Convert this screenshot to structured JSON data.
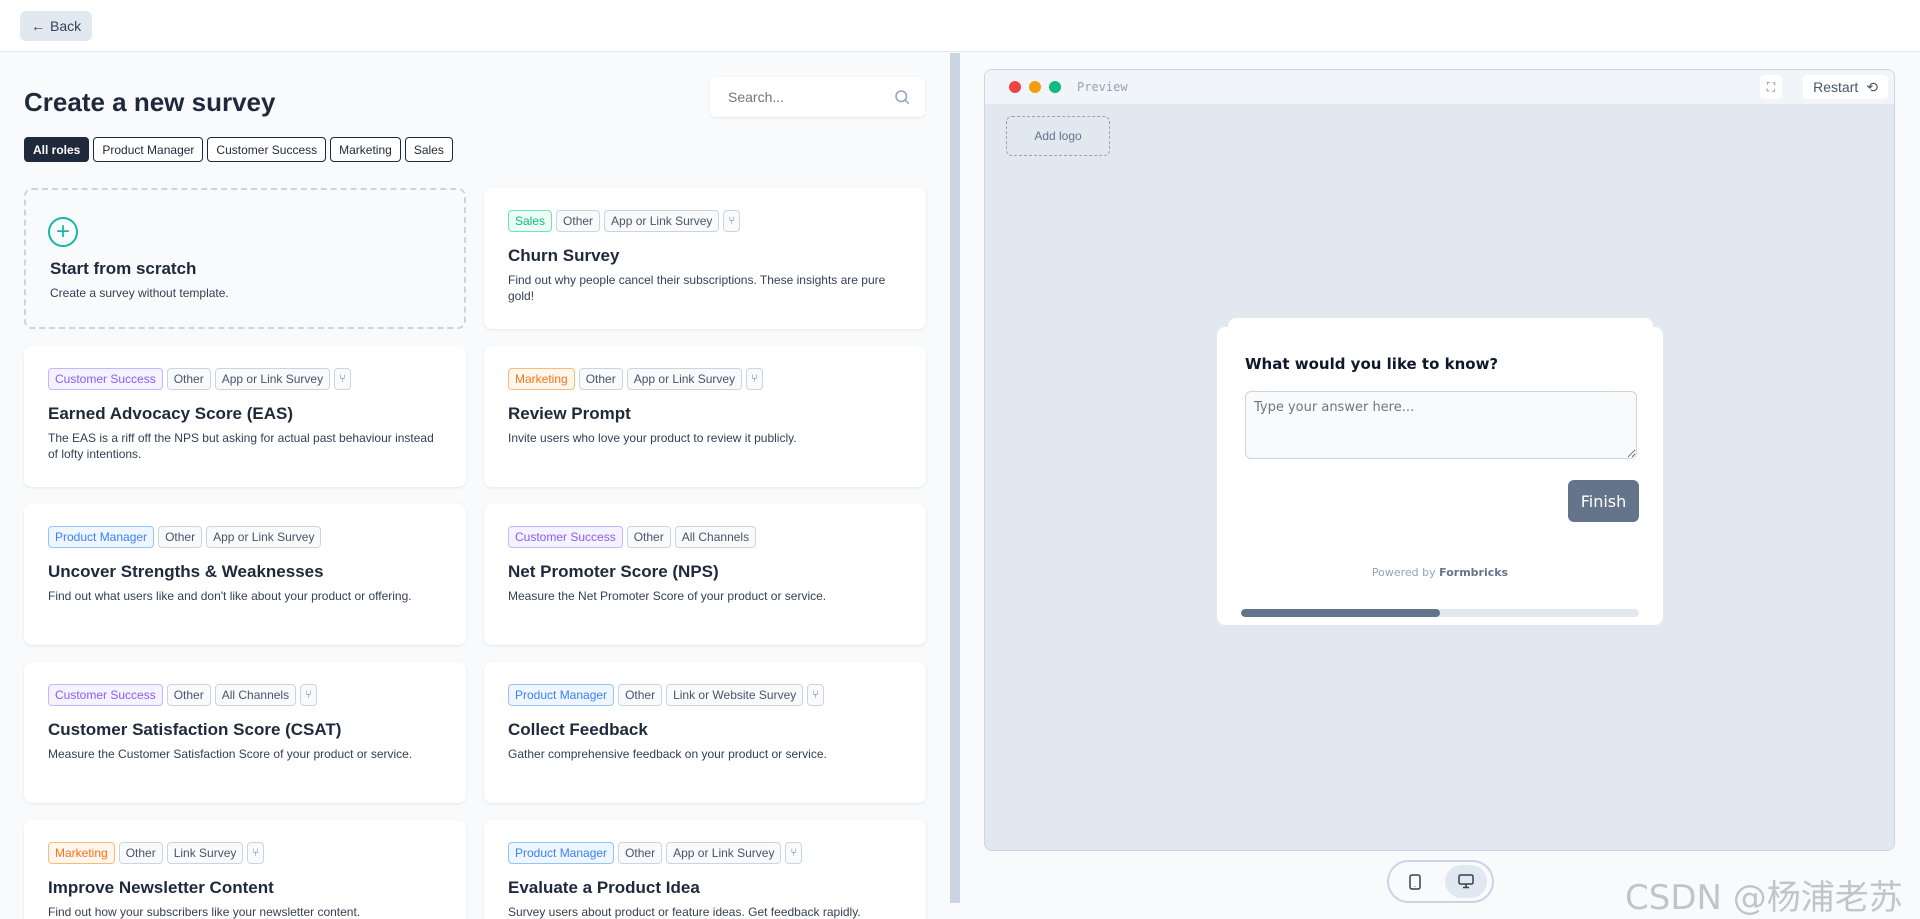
{
  "topbar": {
    "back_label": "Back"
  },
  "left": {
    "title": "Create a new survey",
    "search_placeholder": "Search...",
    "roles": [
      "All roles",
      "Product Manager",
      "Customer Success",
      "Marketing",
      "Sales"
    ],
    "active_role": "All roles",
    "scratch": {
      "title": "Start from scratch",
      "description": "Create a survey without template."
    },
    "templates": [
      {
        "role": "Sales",
        "role_class": "role-sales",
        "tags": [
          "Other",
          "App or Link Survey"
        ],
        "branching": true,
        "title": "Churn Survey",
        "description": "Find out why people cancel their subscriptions. These insights are pure gold!"
      },
      {
        "role": "Customer Success",
        "role_class": "role-cs",
        "tags": [
          "Other",
          "App or Link Survey"
        ],
        "branching": true,
        "title": "Earned Advocacy Score (EAS)",
        "description": "The EAS is a riff off the NPS but asking for actual past behaviour instead of lofty intentions."
      },
      {
        "role": "Marketing",
        "role_class": "role-mk",
        "tags": [
          "Other",
          "App or Link Survey"
        ],
        "branching": true,
        "title": "Review Prompt",
        "description": "Invite users who love your product to review it publicly."
      },
      {
        "role": "Product Manager",
        "role_class": "role-pm",
        "tags": [
          "Other",
          "App or Link Survey"
        ],
        "branching": false,
        "title": "Uncover Strengths & Weaknesses",
        "description": "Find out what users like and don't like about your product or offering."
      },
      {
        "role": "Customer Success",
        "role_class": "role-cs",
        "tags": [
          "Other",
          "All Channels"
        ],
        "branching": false,
        "title": "Net Promoter Score (NPS)",
        "description": "Measure the Net Promoter Score of your product or service."
      },
      {
        "role": "Customer Success",
        "role_class": "role-cs",
        "tags": [
          "Other",
          "All Channels"
        ],
        "branching": true,
        "title": "Customer Satisfaction Score (CSAT)",
        "description": "Measure the Customer Satisfaction Score of your product or service."
      },
      {
        "role": "Product Manager",
        "role_class": "role-pm",
        "tags": [
          "Other",
          "Link or Website Survey"
        ],
        "branching": true,
        "title": "Collect Feedback",
        "description": "Gather comprehensive feedback on your product or service."
      },
      {
        "role": "Marketing",
        "role_class": "role-mk",
        "tags": [
          "Other",
          "Link Survey"
        ],
        "branching": true,
        "title": "Improve Newsletter Content",
        "description": "Find out how your subscribers like your newsletter content."
      },
      {
        "role": "Product Manager",
        "role_class": "role-pm",
        "tags": [
          "Other",
          "App or Link Survey"
        ],
        "branching": true,
        "title": "Evaluate a Product Idea",
        "description": "Survey users about product or feature ideas. Get feedback rapidly."
      }
    ]
  },
  "preview": {
    "label": "Preview",
    "restart_label": "Restart",
    "add_logo": "Add logo",
    "question": "What would you like to know?",
    "answer_placeholder": "Type your answer here...",
    "finish_label": "Finish",
    "powered_by": "Powered by",
    "brand": "Formbricks",
    "progress_percent": 50,
    "active_device": "desktop",
    "dot_colors": [
      "#ef4444",
      "#f59e0b",
      "#10b981"
    ]
  },
  "watermark": "CSDN @杨浦老苏"
}
